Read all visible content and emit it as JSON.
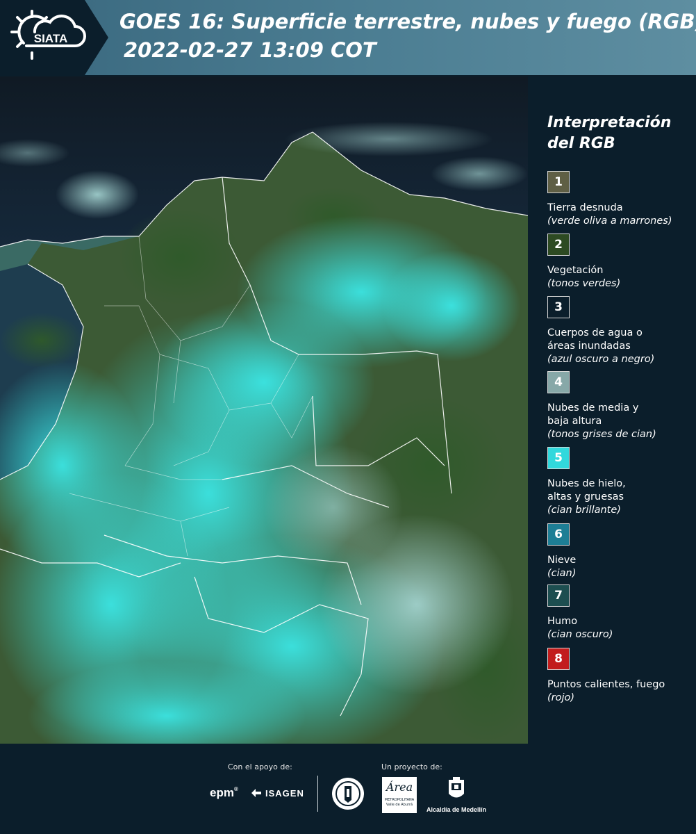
{
  "header": {
    "logo_text": "SIATA",
    "title_line1": "GOES 16: Superficie terrestre, nubes y fuego (RGB)",
    "title_line2": "2022-02-27 13:09 COT"
  },
  "legend": {
    "title_line1": "Interpretación",
    "title_line2": "del RGB",
    "items": [
      {
        "num": "1",
        "color": "#5f5f45",
        "label": "Tierra desnuda",
        "desc": "(verde oliva a marrones)"
      },
      {
        "num": "2",
        "color": "#2d4a22",
        "label": "Vegetación",
        "desc": "(tonos verdes)"
      },
      {
        "num": "3",
        "color": "#0b1e2b",
        "label": "Cuerpos de agua o áreas inundadas",
        "desc": "(azul oscuro a negro)"
      },
      {
        "num": "4",
        "color": "#87a8a8",
        "label": "Nubes de media y baja altura",
        "desc": "(tonos grises de cian)"
      },
      {
        "num": "5",
        "color": "#31d8dc",
        "label": "Nubes de hielo, altas y gruesas",
        "desc": "(cian brillante)"
      },
      {
        "num": "6",
        "color": "#1d7e95",
        "label": "Nieve",
        "desc": "(cian)"
      },
      {
        "num": "7",
        "color": "#1d4e50",
        "label": "Humo",
        "desc": "(cian oscuro)"
      },
      {
        "num": "8",
        "color": "#c21d1d",
        "label": "Puntos calientes, fuego",
        "desc": "(rojo)"
      }
    ]
  },
  "footer": {
    "support_caption": "Con el apoyo de:",
    "project_caption": "Un proyecto de:",
    "epm_text": "epm",
    "isagen_text": "ISAGEN",
    "area_text": "Área",
    "area_sub": "METROPOLITANA",
    "area_sub2": "Valle de Aburrá",
    "alcaldia_text": "Alcaldía de Medellín"
  }
}
